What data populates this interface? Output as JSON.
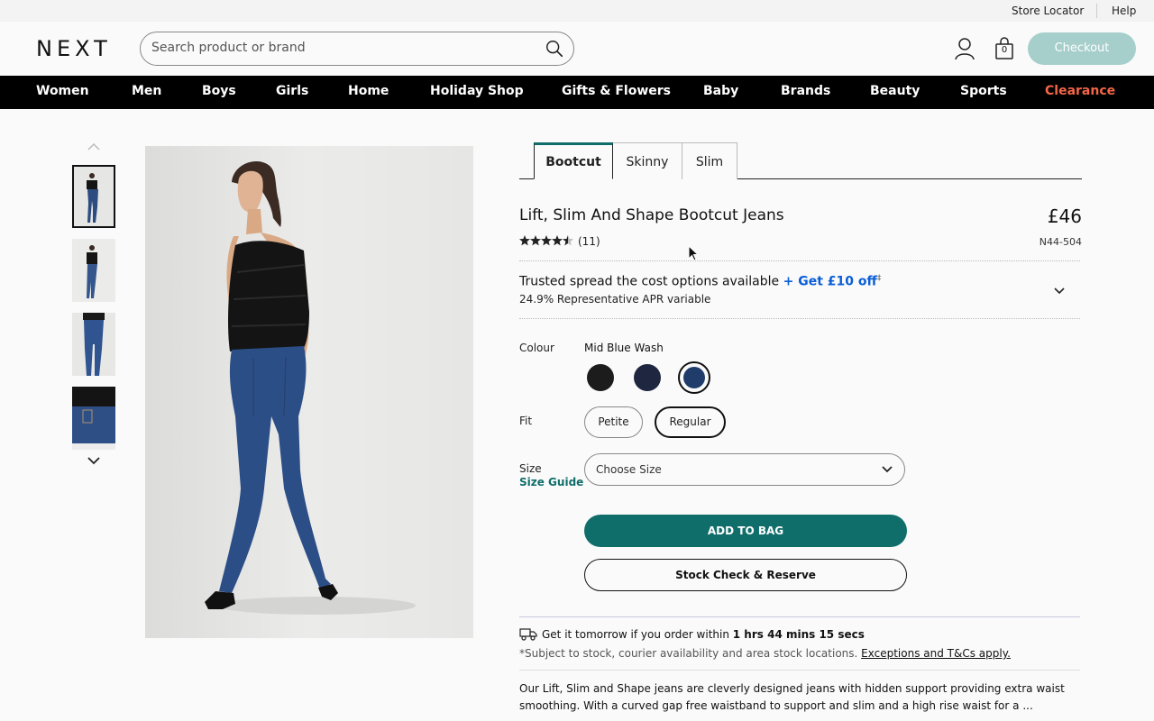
{
  "utility_bar": {
    "store_locator": "Store Locator",
    "help": "Help"
  },
  "header": {
    "logo": "NEXT",
    "search_placeholder": "Search product or brand",
    "bag_count": "0",
    "checkout_label": "Checkout",
    "checkout_color": "#a6cfcb"
  },
  "nav": {
    "items": [
      "Women",
      "Men",
      "Boys",
      "Girls",
      "Home",
      "Holiday Shop",
      "Gifts & Flowers",
      "Baby",
      "Brands",
      "Beauty",
      "Sports",
      "Clearance"
    ],
    "clearance_color": "#f26646"
  },
  "gallery": {
    "thumbnail_count": 4,
    "active_thumbnail": 1
  },
  "product": {
    "fit_tabs": [
      "Bootcut",
      "Skinny",
      "Slim"
    ],
    "active_fit_tab": "Bootcut",
    "title": "Lift, Slim And Shape Bootcut Jeans",
    "price": "£46",
    "rating": 4.5,
    "stars": "★★★★★",
    "review_count": "(11)",
    "code": "N44-504"
  },
  "credit": {
    "text": "Trusted spread the cost options available",
    "link": "+ Get £10 off",
    "dagger": "‡",
    "apr": "24.9% Representative APR variable"
  },
  "colour": {
    "label": "Colour",
    "selected_name": "Mid Blue Wash",
    "swatches": [
      {
        "name": "black",
        "color": "#1c1c1c"
      },
      {
        "name": "navy",
        "color": "#1f2640"
      },
      {
        "name": "mid-blue-wash",
        "color": "#203c6b",
        "selected": true
      }
    ]
  },
  "fit": {
    "label": "Fit",
    "options": [
      "Petite",
      "Regular"
    ],
    "selected": "Regular"
  },
  "size": {
    "label": "Size",
    "guide": "Size Guide",
    "placeholder": "Choose Size"
  },
  "actions": {
    "add_to_bag": "ADD TO BAG",
    "stock_check": "Stock Check & Reserve",
    "accent_color": "#0f6e6a"
  },
  "delivery": {
    "prefix": "Get it tomorrow if you order within",
    "countdown": "1 hrs 44 mins 15 secs",
    "note": "*Subject to stock, courier availability and area stock locations.",
    "tcs_link": "Exceptions and T&Cs apply."
  },
  "description": "Our Lift, Slim and Shape jeans are cleverly designed jeans with hidden support providing extra waist smoothing. With a curved gap free waistband to support and slim and a high rise waist for a ..."
}
